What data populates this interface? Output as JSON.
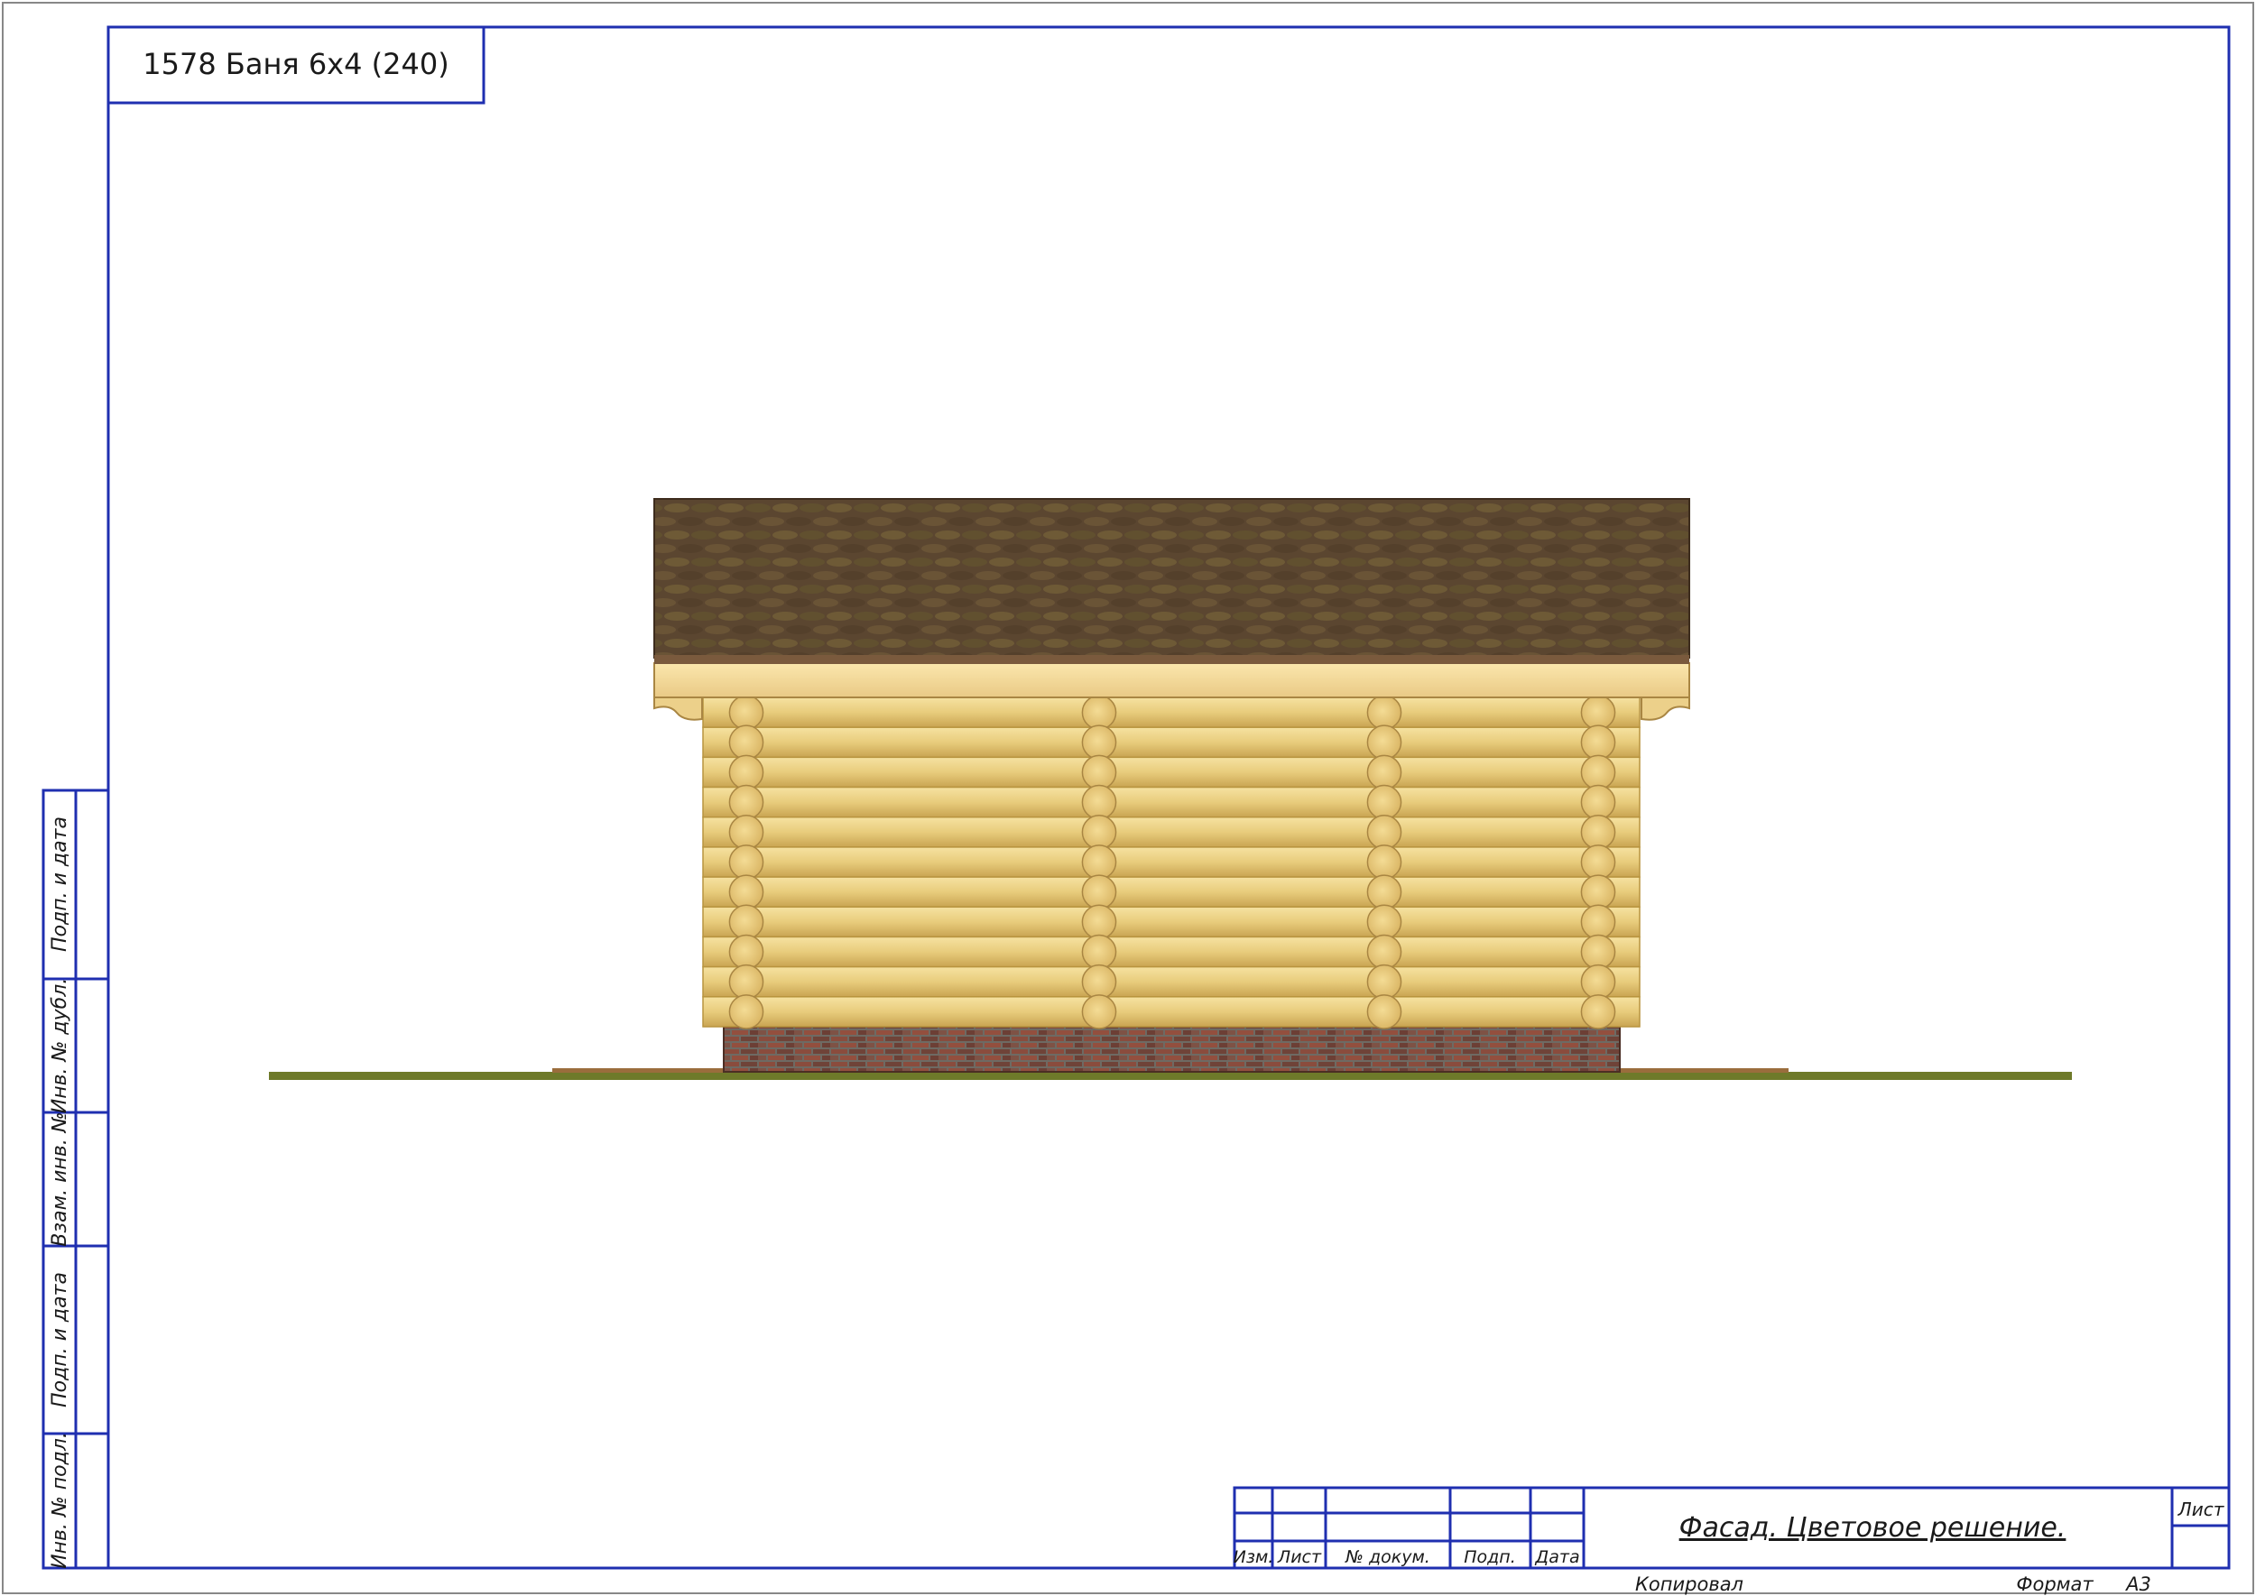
{
  "sheet": {
    "project_title": "1578 Баня 6х4 (240)",
    "drawing_title": "Фасад. Цветовое решение.",
    "sheet_label": "Лист",
    "copied_label": "Копировал",
    "format_label": "Формат",
    "format_value": "А3"
  },
  "stamp_columns": [
    "Изм.",
    "Лист",
    "№ докум.",
    "Подп.",
    "Дата"
  ],
  "side_stamp": [
    "Подп. и дата",
    "Инв. № дубл.",
    "Взам. инв. №",
    "Подп. и дата",
    "Инв. № подл."
  ],
  "colors": {
    "frame": "#1f2fb0",
    "roof": "#5b4630",
    "log": "#e8cf84",
    "log_seam": "#b8943f",
    "fascia": "#f3db99",
    "brick": "#7d4b3c",
    "ground": "#6e7a2a"
  },
  "drawing": {
    "roof_material": "shingles",
    "wall_material": "round-log",
    "plinth_material": "brick",
    "log_rows": 11
  }
}
